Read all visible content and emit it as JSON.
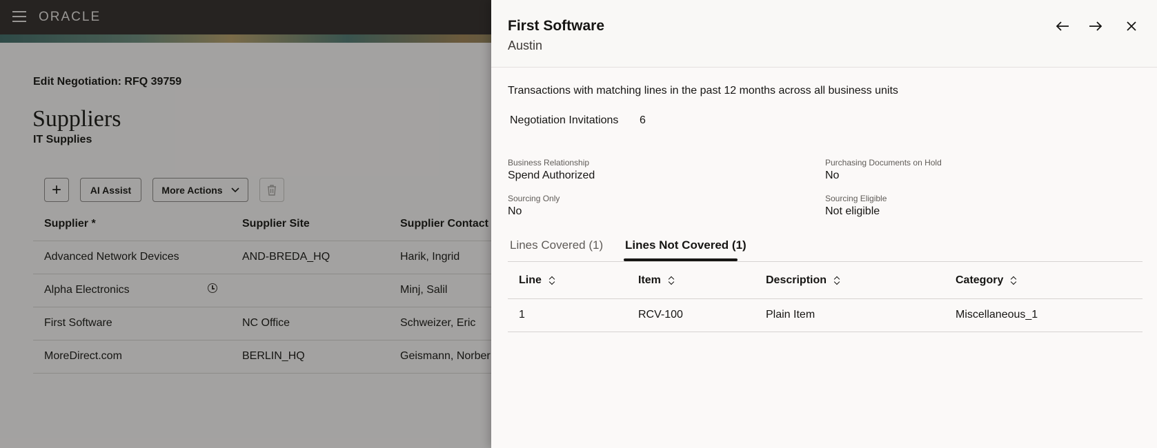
{
  "app": {
    "logo": "ORACLE"
  },
  "page": {
    "edit_title": "Edit Negotiation: RFQ 39759",
    "title": "Suppliers",
    "subtitle": "IT Supplies"
  },
  "toolbar": {
    "add_label": "+",
    "ai_assist_label": "AI Assist",
    "more_actions_label": "More Actions"
  },
  "grid": {
    "headers": [
      "Supplier *",
      "Supplier Site",
      "Supplier Contact"
    ],
    "rows": [
      [
        "Advanced Network Devices",
        "AND-BREDA_HQ",
        "Harik, Ingrid"
      ],
      [
        "Alpha Electronics",
        "",
        "Minj, Salil"
      ],
      [
        "First Software",
        "NC Office",
        "Schweizer, Eric"
      ],
      [
        "MoreDirect.com",
        "BERLIN_HQ",
        "Geismann, Norber"
      ]
    ]
  },
  "drawer": {
    "title": "First Software",
    "subtitle": "Austin",
    "intro": "Transactions with matching lines in the past 12 months across all business units",
    "negotiation_invitations_label": "Negotiation Invitations",
    "negotiation_invitations_value": "6",
    "fields": {
      "business_relationship_label": "Business Relationship",
      "business_relationship_value": "Spend Authorized",
      "purchasing_docs_label": "Purchasing Documents on Hold",
      "purchasing_docs_value": "No",
      "sourcing_only_label": "Sourcing Only",
      "sourcing_only_value": "No",
      "sourcing_eligible_label": "Sourcing Eligible",
      "sourcing_eligible_value": "Not eligible"
    },
    "tabs": [
      "Lines Covered (1)",
      "Lines Not Covered (1)"
    ],
    "active_tab": "Lines Not Covered (1)",
    "table": {
      "headers": [
        "Line",
        "Item",
        "Description",
        "Category"
      ],
      "rows": [
        [
          "1",
          "RCV-100",
          "Plain Item",
          "Miscellaneous_1"
        ]
      ]
    },
    "icons": {
      "prev": "arrow-left-icon",
      "next": "arrow-right-icon",
      "close": "close-icon"
    }
  }
}
